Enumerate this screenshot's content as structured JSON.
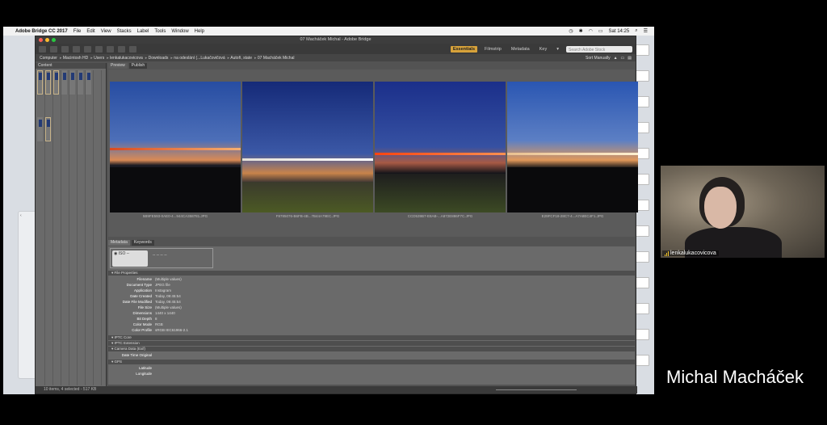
{
  "mac_menubar": {
    "app_name": "Adobe Bridge CC 2017",
    "menus": [
      "File",
      "Edit",
      "View",
      "Stacks",
      "Label",
      "Tools",
      "Window",
      "Help"
    ],
    "clock": "Sat 14:25"
  },
  "bridge": {
    "window_title": "07 Macháček Michal - Adobe Bridge",
    "workspaces": [
      "Essentials",
      "Filmstrip",
      "Metadata",
      "Key"
    ],
    "active_workspace": "Essentials",
    "search_placeholder": "Search Adobe Stock",
    "path": [
      "Computer",
      "Macintosh HD",
      "Users",
      "lenkalukacovicova",
      "Downloads",
      "na odeslání (...Lukačovičová",
      "Autoři, state",
      "07 Macháček Michal"
    ],
    "sort_label": "Sort Manually",
    "left_tab": "Content",
    "content_tabs": [
      "Preview",
      "Publish"
    ],
    "thumbnails": [
      {
        "label": "5B9FE593-0AE0-4...944CA358781.JPG"
      },
      {
        "label": "F8785076-B6FB-4B...7B44A79EC.JPG"
      },
      {
        "label": "CCD539B7-E8AB-...A872E886F7C.JPG"
      },
      {
        "label": "E29FCF18-28C7-4...A7A8EC4F1.JPG"
      }
    ],
    "meta_tabs": [
      "Metadata",
      "Keywords"
    ],
    "placard": {
      "iso": "ISO --",
      "values": [
        "--",
        "--",
        "--",
        "--"
      ]
    },
    "sections": {
      "file_properties": "File Properties",
      "iptc_core": "IPTC Core",
      "iptc_extension": "IPTC Extension",
      "camera_data": "Camera Data (Exif)",
      "gps": "GPS"
    },
    "file_properties": [
      {
        "key": "Filename",
        "value": "(Multiple values)"
      },
      {
        "key": "Document Type",
        "value": "JPEG file"
      },
      {
        "key": "Application",
        "value": "Instagram"
      },
      {
        "key": "Date Created",
        "value": "Today, 09:45:54"
      },
      {
        "key": "Date File Modified",
        "value": "Today, 09:45:54"
      },
      {
        "key": "File Size",
        "value": "(Multiple values)"
      },
      {
        "key": "Dimensions",
        "value": "1440 x 1440"
      },
      {
        "key": "Bit Depth",
        "value": "8"
      },
      {
        "key": "Color Mode",
        "value": "RGB"
      },
      {
        "key": "Color Profile",
        "value": "sRGB IEC61966-2.1"
      }
    ],
    "camera_rows": [
      {
        "key": "Date Time Original",
        "value": ""
      }
    ],
    "gps_rows": [
      {
        "key": "Latitude",
        "value": ""
      },
      {
        "key": "Longitude",
        "value": ""
      }
    ],
    "status": "10 items, 4 selected - 517 KB"
  },
  "webcam": {
    "participant_name": "lenkalukacovicova"
  },
  "presenter_name": "Michal Macháček",
  "colors": {
    "accent": "#d7a23a",
    "bridge_bg": "#535353",
    "panel": "#6a6a6a"
  }
}
